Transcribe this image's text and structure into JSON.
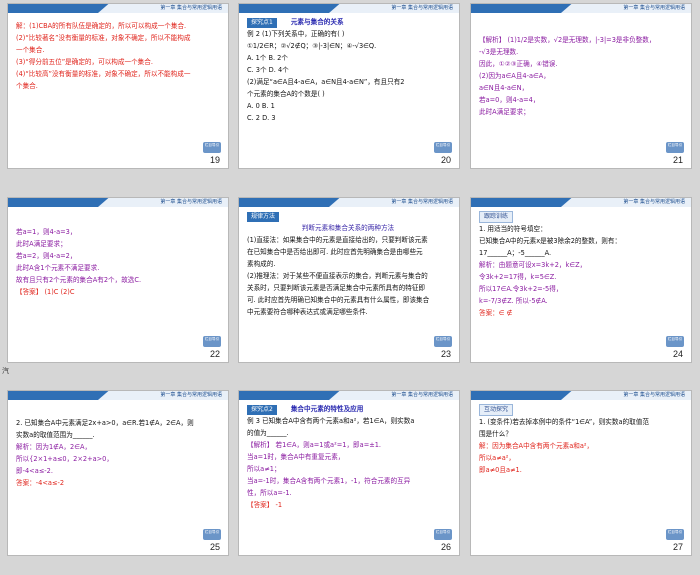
{
  "header_text": "第一章 集合与常用逻辑用语",
  "back_label": "栏目导引",
  "side_mark": "汽",
  "slides": [
    {
      "number": "19",
      "lines": [
        {
          "text": "解：(1)CBA的所有队伍是确定的，所以可以构成一个集合.",
          "cls": "red"
        },
        {
          "text": "(2)“比较著名”没有衡量的标准，对象不确定，所以不能构成",
          "cls": "red"
        },
        {
          "text": "一个集合.",
          "cls": "red"
        },
        {
          "text": "(3)“得分前五位”是确定的，可以构成一个集合.",
          "cls": "red"
        },
        {
          "text": "(4)“比较高”没有衡量的标准，对象不确定，所以不能构成一",
          "cls": "red"
        },
        {
          "text": "个集合.",
          "cls": "red"
        }
      ]
    },
    {
      "number": "20",
      "tag": "探究点1",
      "tag2": "元素与集合的关系",
      "lines": [
        {
          "text": "例 2   (1)下列关系中，正确的有(     )",
          "cls": ""
        },
        {
          "text": "①1/2∈R；②√2∉Q；③|-3|∈N；④-√3∈Q.",
          "cls": ""
        },
        {
          "text": "A. 1个                          B. 2个",
          "cls": ""
        },
        {
          "text": "C. 3个                          D. 4个",
          "cls": ""
        },
        {
          "text": "(2)满足“a∈A且4-a∈A，a∈N且4-a∈N”，有且只有2",
          "cls": ""
        },
        {
          "text": "个元素的集合A的个数是(     )",
          "cls": ""
        },
        {
          "text": "A. 0                             B. 1",
          "cls": ""
        },
        {
          "text": "C. 2                             D. 3",
          "cls": ""
        }
      ]
    },
    {
      "number": "21",
      "lines": [
        {
          "text": "【解析】  (1)1/2是实数，√2是无理数，|-3|=3是非负整数，",
          "cls": "purple"
        },
        {
          "text": "-√3是无理数.",
          "cls": "purple"
        },
        {
          "text": "因此，①②③正确，④错误.",
          "cls": "purple"
        },
        {
          "text": "(2)因为a∈A且4-a∈A，",
          "cls": "purple"
        },
        {
          "text": "a∈N且4-a∈N，",
          "cls": "purple"
        },
        {
          "text": "若a=0，则4-a=4，",
          "cls": "purple"
        },
        {
          "text": "此时A满足要求；",
          "cls": "purple"
        }
      ]
    },
    {
      "number": "22",
      "lines": [
        {
          "text": "若a=1，则4-a=3，",
          "cls": "purple"
        },
        {
          "text": "此时A满足要求；",
          "cls": "purple"
        },
        {
          "text": "若a=2，则4-a=2，",
          "cls": "purple"
        },
        {
          "text": "此时A含1个元素不满足要求.",
          "cls": "purple"
        },
        {
          "text": "故有且只有2个元素的集合A有2个，故选C.",
          "cls": "purple"
        },
        {
          "text": "【答案】  (1)C   (2)C",
          "cls": "red"
        }
      ]
    },
    {
      "number": "23",
      "tag": "规律方法",
      "lines": [
        {
          "text": "判断元素和集合关系的两种方法",
          "cls": "blue"
        },
        {
          "text": "(1)直接法：如果集合中的元素是直接给出的，只要判断该元素",
          "cls": ""
        },
        {
          "text": "在已知集合中是否给出即可. 此时应首先明确集合是由哪些元",
          "cls": ""
        },
        {
          "text": "素构成的.",
          "cls": ""
        },
        {
          "text": "(2)推理法：对于某些不便直接表示的集合，判断元素与集合的",
          "cls": ""
        },
        {
          "text": "关系时，只要判断该元素是否满足集合中元素所具有的特征即",
          "cls": ""
        },
        {
          "text": "可. 此时应首先明确已知集合中的元素具有什么属性，即该集合",
          "cls": ""
        },
        {
          "text": "中元素要符合哪种表达式或满足哪些条件.",
          "cls": ""
        }
      ]
    },
    {
      "number": "24",
      "tag": "跟踪训练",
      "lines": [
        {
          "text": "1. 用适当的符号填空：",
          "cls": ""
        },
        {
          "text": "已知集合A中的元素x是被3除余2的整数，则有：",
          "cls": ""
        },
        {
          "text": "17______A；-5______A.",
          "cls": ""
        },
        {
          "text": "解析：由题意可设x=3k+2，k∈Z，",
          "cls": "purple"
        },
        {
          "text": "令3k+2=17得，k=5∈Z.",
          "cls": "purple"
        },
        {
          "text": "所以17∈A.令3k+2=-5得，",
          "cls": "purple"
        },
        {
          "text": "k=-7/3∉Z. 所以-5∉A.",
          "cls": "purple"
        },
        {
          "text": "答案：∈  ∉",
          "cls": "red"
        }
      ]
    },
    {
      "number": "25",
      "lines": [
        {
          "text": "2. 已知集合A中元素满足2x+a>0，a∈R.若1∉A，2∈A，则",
          "cls": ""
        },
        {
          "text": "实数a的取值范围为______.",
          "cls": ""
        },
        {
          "text": "解析：因为1∉A，2∈A，",
          "cls": "purple"
        },
        {
          "text": "所以{2×1+a≤0，2×2+a>0，",
          "cls": "purple"
        },
        {
          "text": "即-4<a≤-2.",
          "cls": "purple"
        },
        {
          "text": "答案：-4<a≤-2",
          "cls": "red"
        }
      ]
    },
    {
      "number": "26",
      "tag": "探究点2",
      "tag2": "集合中元素的特性及应用",
      "lines": [
        {
          "text": "例 3   已知集合A中含有两个元素a和a²，若1∈A，则实数a",
          "cls": ""
        },
        {
          "text": "的值为______.",
          "cls": ""
        },
        {
          "text": "【解析】  若1∈A，则a=1或a²=1，即a=±1.",
          "cls": "purple"
        },
        {
          "text": "当a=1时，集合A中有重复元素，",
          "cls": "purple"
        },
        {
          "text": "所以a≠1；",
          "cls": "purple"
        },
        {
          "text": "当a=-1时，集合A含有两个元素1，-1，符合元素的互异",
          "cls": "purple"
        },
        {
          "text": "性，所以a=-1.",
          "cls": "purple"
        },
        {
          "text": "【答案】  -1",
          "cls": "red"
        }
      ]
    },
    {
      "number": "27",
      "tag": "互动探究",
      "lines": [
        {
          "text": "1. (变条件)若去掉本例中的条件“1∈A”，则实数a的取值范",
          "cls": ""
        },
        {
          "text": "围是什么？",
          "cls": ""
        },
        {
          "text": "解：因为集合A中含有两个元素a和a²，",
          "cls": "red"
        },
        {
          "text": "所以a≠a²，",
          "cls": "red"
        },
        {
          "text": "即a≠0且a≠1.",
          "cls": "red"
        }
      ]
    }
  ]
}
